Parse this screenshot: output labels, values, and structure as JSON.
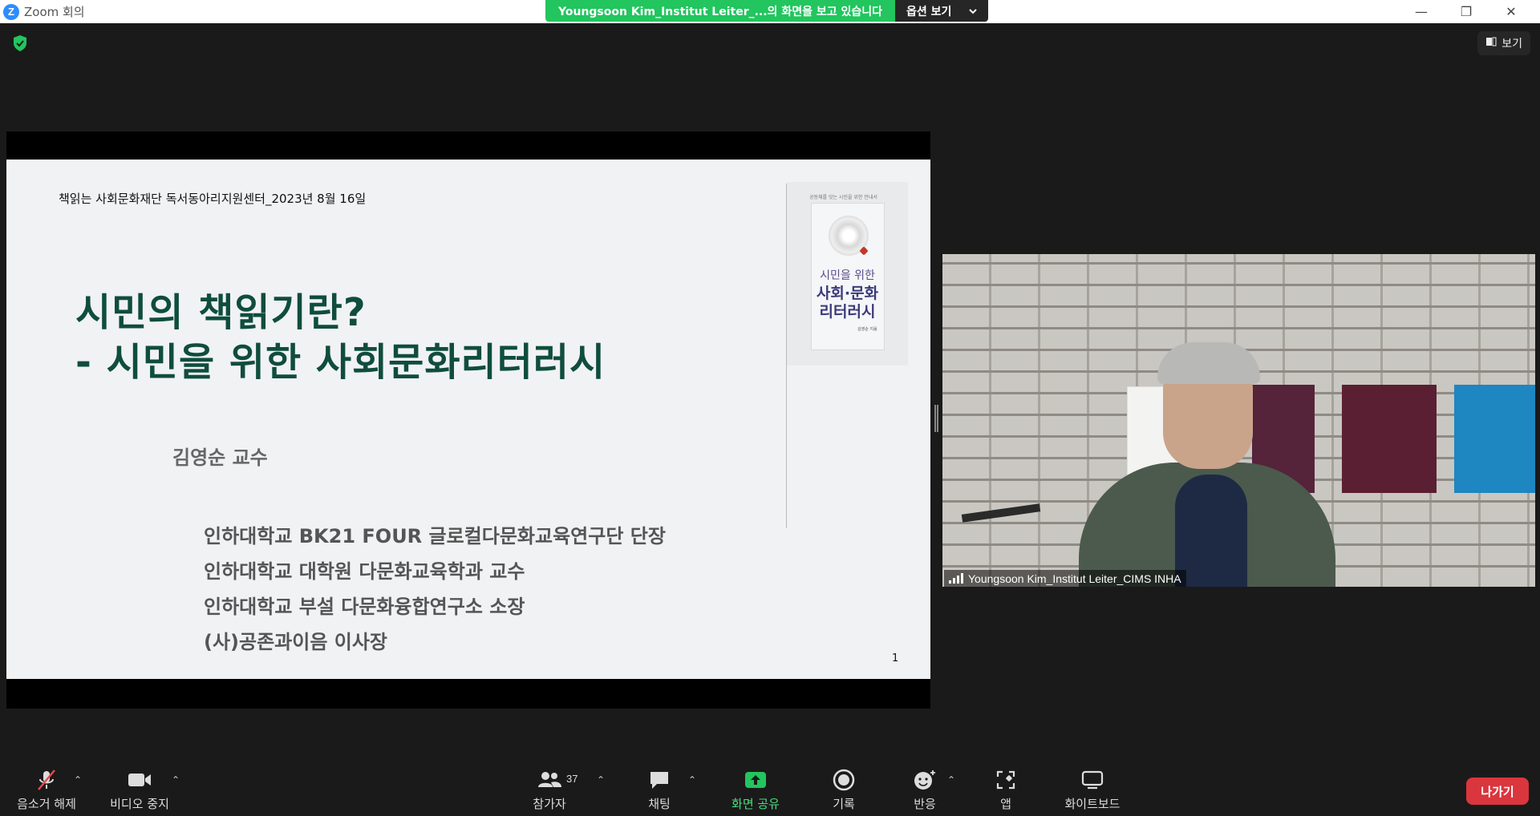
{
  "window": {
    "logo": "Z",
    "title": "Zoom 회의",
    "controls": {
      "minimize": "—",
      "restore": "❐",
      "close": "✕"
    }
  },
  "share_banner": {
    "message": "Youngsoon  Kim_Institut  Leiter_...의 화면을 보고 있습니다",
    "options_label": "옵션 보기",
    "options_icon": "chevron-down-icon"
  },
  "security_icon": "shield-check-icon",
  "view_button": {
    "label": "보기",
    "icon": "layout-icon"
  },
  "slide": {
    "header": "책읽는 사회문화재단 독서동아리지원센터_2023년 8월 16일",
    "title_lines": [
      "시민의 책읽기란?",
      "- 시민을 위한 사회문화리터러시"
    ],
    "presenter": "김영순 교수",
    "affiliations": [
      "인하대학교 BK21 FOUR 글로컬다문화교육연구단 단장",
      "인하대학교 대학원 다문화교육학과 교수",
      "인하대학교 부설 다문화융합연구소 소장",
      "(사)공존과이음 이사장"
    ],
    "page_number": "1",
    "book": {
      "tagline": "공동체를 잇는 시민을 위한 안내서",
      "title_small": "시민을 위한",
      "title_big_1": "사회·문화",
      "title_big_2": "리터러시",
      "author": "김영순 지음"
    }
  },
  "video": {
    "participant_name": "Youngsoon Kim_Institut Leiter_CIMS INHA"
  },
  "toolbar": {
    "mute": {
      "label": "음소거 해제",
      "icon": "mic-muted-icon"
    },
    "video": {
      "label": "비디오 중지",
      "icon": "video-camera-icon"
    },
    "participants": {
      "label": "참가자",
      "count": "37",
      "icon": "participants-icon"
    },
    "chat": {
      "label": "채팅",
      "icon": "chat-icon"
    },
    "share": {
      "label": "화면 공유",
      "icon": "share-screen-icon",
      "color": "#22c55e"
    },
    "record": {
      "label": "기록",
      "icon": "record-icon"
    },
    "reactions": {
      "label": "반응",
      "icon": "emoji-icon"
    },
    "apps": {
      "label": "앱",
      "icon": "apps-icon"
    },
    "whiteboard": {
      "label": "화이트보드",
      "icon": "whiteboard-icon"
    },
    "leave": {
      "label": "나가기",
      "color": "#d9363e"
    },
    "caret": "⌃"
  }
}
